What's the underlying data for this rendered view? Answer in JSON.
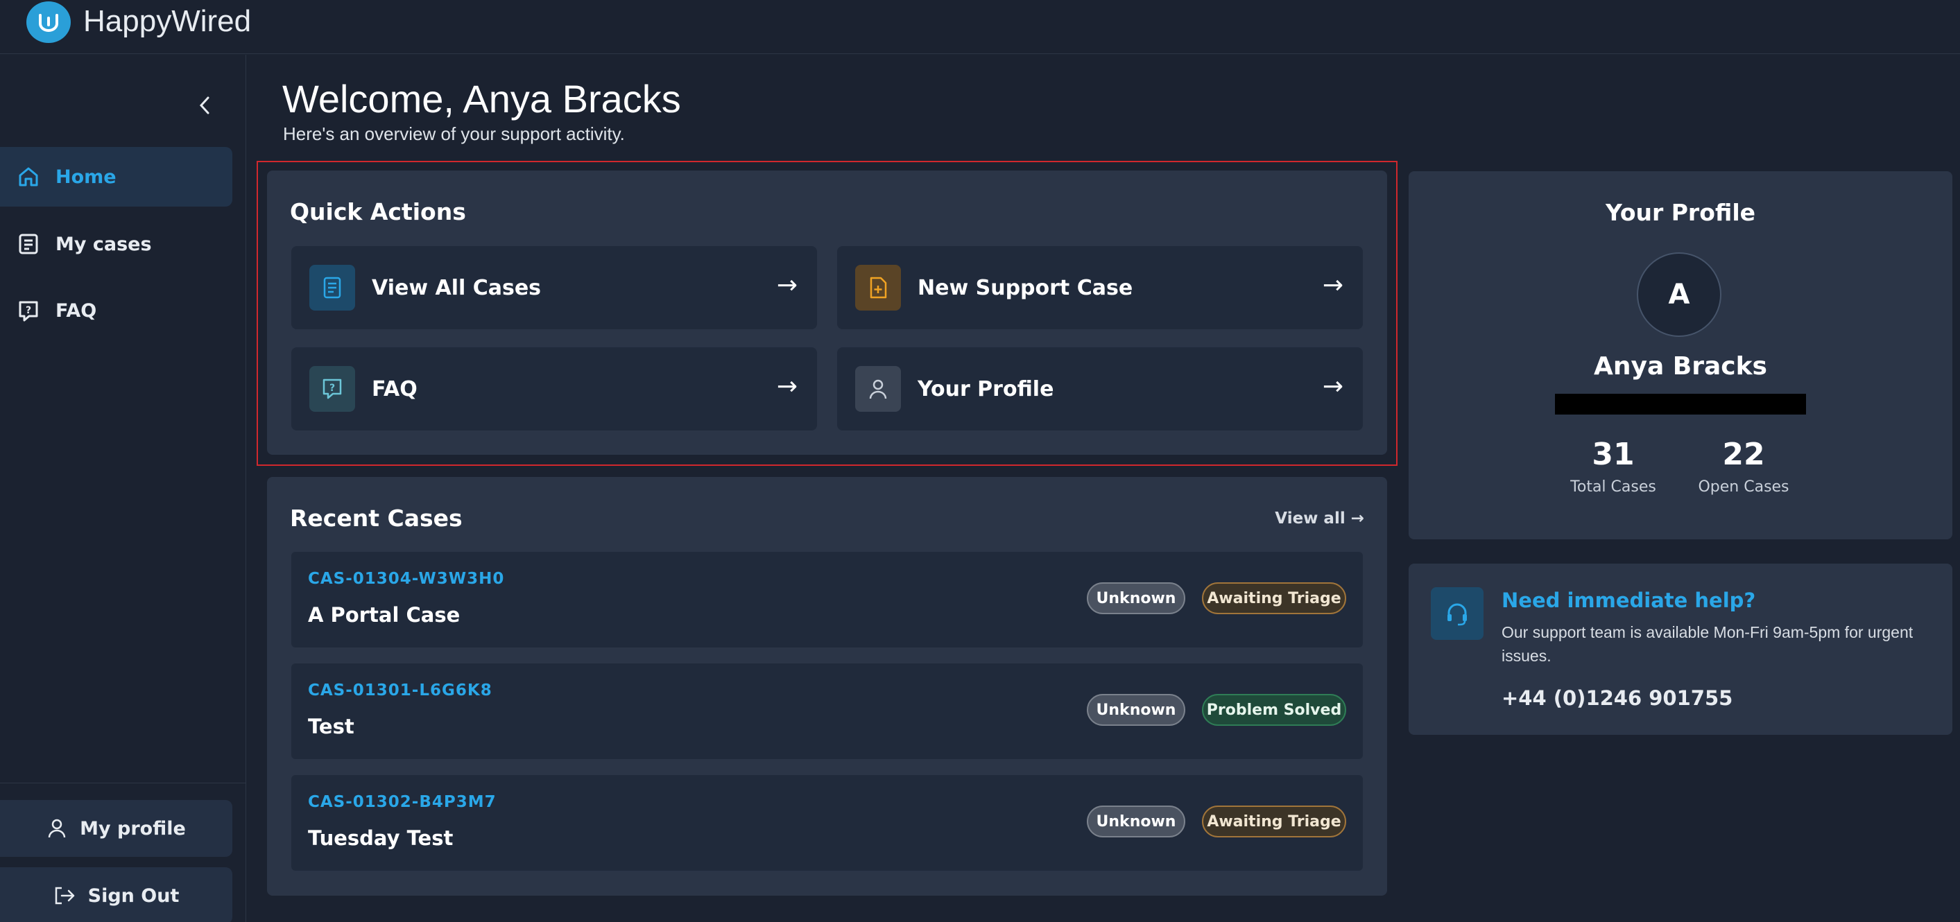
{
  "app": {
    "name": "HappyWired",
    "logo_letter": "W"
  },
  "colors": {
    "accent": "#2aa7e8",
    "background": "#1b2230",
    "card": "#2b3547",
    "highlight": "#d0282d"
  },
  "sidebar": {
    "items": [
      {
        "label": "Home",
        "icon": "home-icon",
        "active": true
      },
      {
        "label": "My cases",
        "icon": "document-icon",
        "active": false
      },
      {
        "label": "FAQ",
        "icon": "question-icon",
        "active": false
      }
    ],
    "profile_label": "My profile",
    "signout_label": "Sign Out"
  },
  "header": {
    "welcome": "Welcome, Anya Bracks",
    "subtitle": "Here's an overview of your support activity."
  },
  "quick_actions": {
    "title": "Quick Actions",
    "items": [
      {
        "label": "View All Cases",
        "icon": "document-list-icon"
      },
      {
        "label": "New Support Case",
        "icon": "new-document-icon"
      },
      {
        "label": "FAQ",
        "icon": "question-icon"
      },
      {
        "label": "Your Profile",
        "icon": "user-icon"
      }
    ],
    "arrow": "→"
  },
  "recent_cases": {
    "title": "Recent Cases",
    "view_all": "View all →",
    "cases": [
      {
        "id": "CAS-01304-W3W3H0",
        "title": "A Portal Case",
        "priority": "Unknown",
        "status": "Awaiting Triage"
      },
      {
        "id": "CAS-01301-L6G6K8",
        "title": "Test",
        "priority": "Unknown",
        "status": "Problem Solved"
      },
      {
        "id": "CAS-01302-B4P3M7",
        "title": "Tuesday Test",
        "priority": "Unknown",
        "status": "Awaiting Triage"
      }
    ]
  },
  "profile": {
    "title": "Your Profile",
    "avatar_letter": "A",
    "name": "Anya Bracks",
    "total_cases": "31",
    "total_cases_label": "Total Cases",
    "open_cases": "22",
    "open_cases_label": "Open Cases"
  },
  "help": {
    "title": "Need immediate help?",
    "text": "Our support team is available Mon-Fri 9am-5pm for urgent issues.",
    "phone": "+44 (0)1246 901755"
  }
}
